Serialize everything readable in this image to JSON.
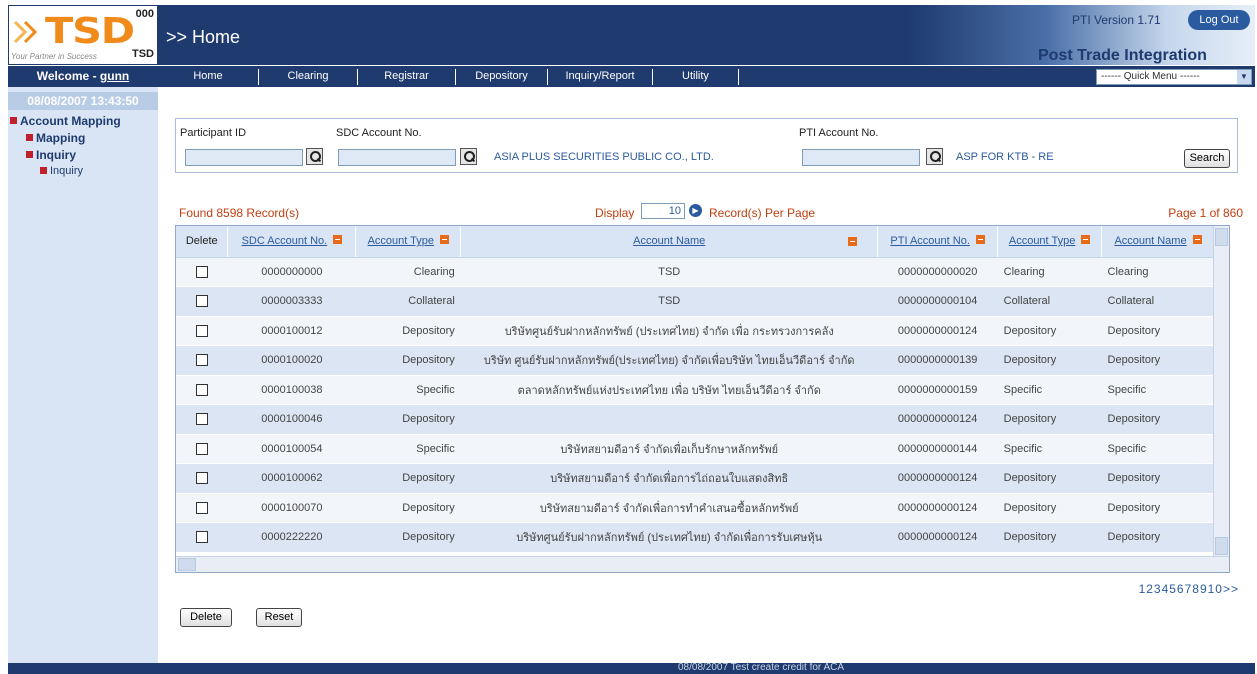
{
  "header": {
    "logo_text": "TSD",
    "logo_tagline": "Your Partner in Success",
    "logo_code": "000",
    "logo_code2": "TSD",
    "breadcrumb": ">> Home",
    "version": "PTI Version 1.71",
    "logout": "Log Out",
    "product_title": "Post Trade Integration"
  },
  "welcome": {
    "prefix": "Welcome - ",
    "user": "gunn"
  },
  "menu": {
    "items": [
      "Home",
      "Clearing",
      "Registrar",
      "Depository",
      "Inquiry/Report",
      "Utility"
    ],
    "quick_menu": "------ Quick Menu ------"
  },
  "sidebar": {
    "datetime": "08/08/2007 13:43:50",
    "tree": {
      "root": "Account Mapping",
      "mapping": "Mapping",
      "inquiry": "Inquiry",
      "inquiry_leaf": "Inquiry"
    }
  },
  "search": {
    "participant_label": "Participant ID",
    "participant_value": "",
    "sdc_label": "SDC Account No.",
    "sdc_value": "",
    "sdc_desc": "ASIA PLUS SECURITIES PUBLIC CO., LTD.",
    "pti_label": "PTI Account No.",
    "pti_value": "",
    "pti_desc": "ASP FOR KTB - RE",
    "search_button": "Search"
  },
  "list": {
    "found": "Found 8598 Record(s)",
    "display_label": "Display",
    "display_value": "10",
    "per_page_label": "Record(s) Per Page",
    "page_of": "Page 1 of 860"
  },
  "table": {
    "headers": [
      "Delete",
      "SDC Account No.",
      "Account Type",
      "Account Name",
      "PTI Account No.",
      "Account Type",
      "Account Name"
    ],
    "rows": [
      [
        "0000000000",
        "Clearing",
        "TSD",
        "0000000000020",
        "Clearing",
        "Clearing"
      ],
      [
        "0000003333",
        "Collateral",
        "TSD",
        "0000000000104",
        "Collateral",
        "Collateral"
      ],
      [
        "0000100012",
        "Depository",
        "บริษัทศูนย์รับฝากหลักทรัพย์ (ประเทศไทย) จำกัด เพื่อ กระทรวงการคลัง",
        "0000000000124",
        "Depository",
        "Depository"
      ],
      [
        "0000100020",
        "Depository",
        "บริษัท ศูนย์รับฝากหลักทรัพย์(ประเทศไทย) จำกัดเพื่อบริษัท ไทยเอ็นวีดีอาร์ จำกัด",
        "0000000000139",
        "Depository",
        "Depository"
      ],
      [
        "0000100038",
        "Specific",
        "ตลาดหลักทรัพย์แห่งประเทศไทย เพื่อ บริษัท ไทยเอ็นวีดีอาร์ จำกัด",
        "0000000000159",
        "Specific",
        "Specific"
      ],
      [
        "0000100046",
        "Depository",
        "",
        "0000000000124",
        "Depository",
        "Depository"
      ],
      [
        "0000100054",
        "Specific",
        "บริษัทสยามดีอาร์ จำกัดเพื่อเก็บรักษาหลักทรัพย์",
        "0000000000144",
        "Specific",
        "Specific"
      ],
      [
        "0000100062",
        "Depository",
        "บริษัทสยามดีอาร์ จำกัดเพื่อการไถ่ถอนใบแสดงสิทธิ",
        "0000000000124",
        "Depository",
        "Depository"
      ],
      [
        "0000100070",
        "Depository",
        "บริษัทสยามดีอาร์ จำกัดเพื่อการทำคำเสนอซื้อหลักทรัพย์",
        "0000000000124",
        "Depository",
        "Depository"
      ],
      [
        "0000222220",
        "Depository",
        "บริษัทศูนย์รับฝากหลักทรัพย์ (ประเทศไทย) จำกัดเพื่อการรับเศษหุ้น",
        "0000000000124",
        "Depository",
        "Depository"
      ]
    ]
  },
  "pager": "12345678910>>",
  "actions": {
    "delete": "Delete",
    "reset": "Reset"
  },
  "footer": "08/08/2007 Test create credit for ACA",
  "colors": {
    "navy": "#1e3a6e",
    "accent": "#e86b1a",
    "link": "#2a5aa0",
    "row_alt": "#dbe5f3"
  }
}
